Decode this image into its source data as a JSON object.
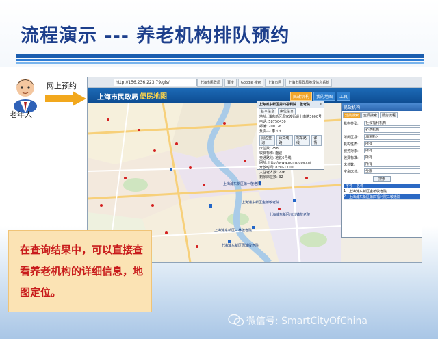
{
  "slide": {
    "title": "流程演示 --- 养老机构排队预约",
    "user_label": "老年人",
    "flow_label": "网上预约",
    "note": "在查询结果中，可以直接查看养老机构的详细信息，地图定位。",
    "watermark": "微信号: SmartCityOfChina"
  },
  "browser": {
    "url": "http://156.236.223.79/gis/",
    "tabs": [
      "上海市民政局",
      "百度",
      "Google 搜索",
      "上海市区",
      "上海市民政局地理信息系统"
    ]
  },
  "app": {
    "title": "上海市民政局",
    "subtitle": "便民地图",
    "nav": [
      "民政机构",
      "我的地图",
      "工具"
    ]
  },
  "map": {
    "labels": [
      "上海浦东新区第一敬老院",
      "上海浦东新区金桥敬老院",
      "上海浦东新区川沙镇敬老院",
      "上海浦东新区三林敬老院",
      "上海浦东新区周浦敬老院"
    ]
  },
  "popup": {
    "title": "上海浦东新区第四福利院二敬老院",
    "tabs": [
      "基本信息",
      "床位信息"
    ],
    "lines": [
      "地址: 浦东新区周家渡街道上南路3600号",
      "电话: 58750430",
      "邮编: 200126",
      "负责人: 李××",
      "床位数: 258",
      "收费标准: 面议",
      "交通路线: 地铁6号线",
      "网址: http://www.pdmz.gov.cn/",
      "开放时间: 8:30-17:00",
      "入住老人数: 226",
      "剩余床位数: 32"
    ],
    "buttons": [
      "周边查询",
      "公交线路",
      "驾车路线",
      "详情"
    ]
  },
  "panel": {
    "header": "民政机构",
    "tabs": [
      "分类搜索",
      "空间搜索",
      "服务流程"
    ],
    "fields": [
      {
        "label": "机构类型:",
        "value": "社会福利机构"
      },
      {
        "label": "",
        "value": "养老机构"
      },
      {
        "label": "所属区县:",
        "value": "浦东新区"
      },
      {
        "label": "机构性质:",
        "value": "所有"
      },
      {
        "label": "服务对象:",
        "value": "所有"
      },
      {
        "label": "收费标准:",
        "value": "所有"
      },
      {
        "label": "床位数:",
        "value": "所有"
      },
      {
        "label": "空余床位:",
        "value": "全部"
      }
    ],
    "search_label": "搜索",
    "result_head": [
      "序号",
      "名称"
    ],
    "results": [
      {
        "idx": "1",
        "name": "上海浦东新区金桥敬老院"
      },
      {
        "idx": "2",
        "name": "上海浦东新区第四福利院二敬老院"
      }
    ]
  },
  "colors": {
    "title": "#1d3f8c",
    "rule": "#1b5eaf",
    "note_bg": "#fbe3b4",
    "note_text": "#c81b1b",
    "app_header": "#1d6bb7"
  }
}
